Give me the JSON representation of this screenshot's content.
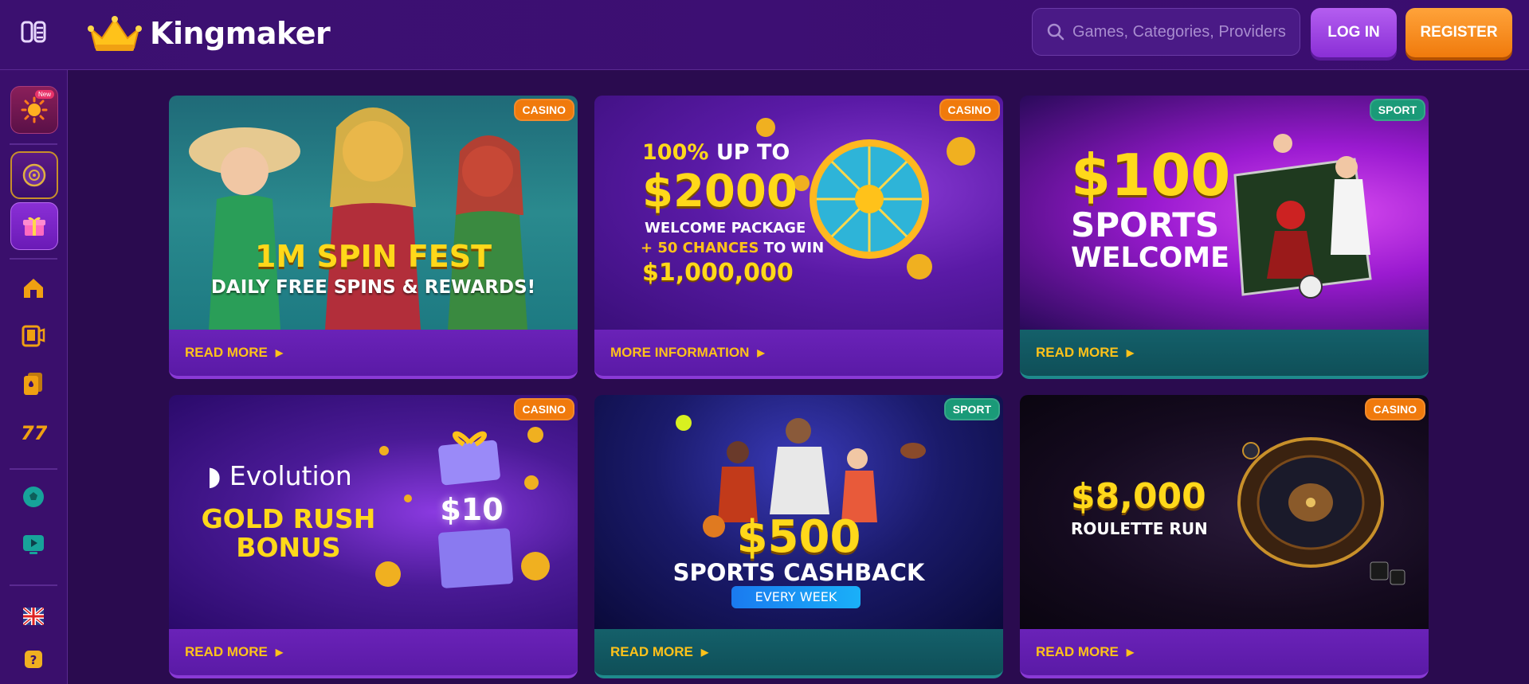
{
  "header": {
    "brand": "Kingmaker",
    "search_placeholder": "Games, Categories, Providers",
    "login_label": "LOG IN",
    "register_label": "REGISTER"
  },
  "sidebar": {
    "new_badge": "New",
    "items": [
      "new-promo",
      "casino-wheel",
      "gifts",
      "home",
      "live-casino",
      "cards",
      "slots",
      "sports",
      "tv",
      "language",
      "help"
    ]
  },
  "colors": {
    "accent_orange": "#f07a0c",
    "accent_purple": "#8a2fd6",
    "link_yellow": "#ffc21a",
    "sport_green": "#1a9a78"
  },
  "cards": [
    {
      "badge": "CASINO",
      "badge_type": "casino",
      "headline": "1M SPIN FEST",
      "subline": "DAILY FREE SPINS & REWARDS!",
      "link": "READ MORE",
      "footer": "purple"
    },
    {
      "badge": "CASINO",
      "badge_type": "casino",
      "line1a": "100%",
      "line1b": "UP TO",
      "amount": "$2000",
      "line2": "WELCOME PACKAGE",
      "line3a": "+ 50 CHANCES",
      "line3b": "TO WIN",
      "jackpot": "$1,000,000",
      "link": "MORE INFORMATION",
      "footer": "purple"
    },
    {
      "badge": "SPORT",
      "badge_type": "sport",
      "amount": "$100",
      "line1": "SPORTS",
      "line2": "WELCOME",
      "link": "READ MORE",
      "footer": "teal"
    },
    {
      "badge": "CASINO",
      "badge_type": "casino",
      "provider": "Evolution",
      "line1": "GOLD RUSH",
      "line2": "BONUS",
      "amount": "$10",
      "link": "READ MORE",
      "footer": "purple"
    },
    {
      "badge": "SPORT",
      "badge_type": "sport",
      "amount": "$500",
      "line1": "SPORTS CASHBACK",
      "pill": "EVERY WEEK",
      "link": "READ MORE",
      "footer": "teal"
    },
    {
      "badge": "CASINO",
      "badge_type": "casino",
      "amount": "$8,000",
      "line1": "ROULETTE RUN",
      "link": "READ MORE",
      "footer": "purple"
    }
  ]
}
